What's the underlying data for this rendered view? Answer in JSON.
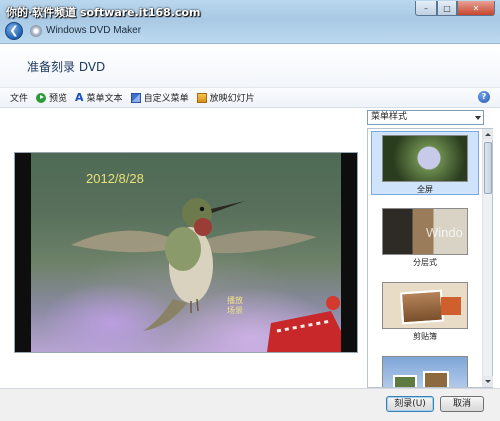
{
  "watermark": "你的·软件频道 software.it168.com",
  "window": {
    "title": "Windows DVD Maker",
    "controls": {
      "minimize": "–",
      "maximize": "□",
      "close": "✕"
    }
  },
  "page_title": "准备刻录 DVD",
  "toolbar": {
    "file": "文件",
    "preview": "预览",
    "menu_text": "菜单文本",
    "customize_menu": "自定义菜单",
    "slideshow": "放映幻灯片",
    "help": "?"
  },
  "preview": {
    "date_text": "2012/8/28",
    "play_label_line1": "播放",
    "play_label_line2": "场景"
  },
  "style_panel": {
    "dropdown_value": "菜单样式",
    "items": [
      {
        "label": "全屏",
        "selected": true
      },
      {
        "label": "分层式",
        "selected": false
      },
      {
        "label": "剪贴簿",
        "selected": false
      },
      {
        "label": "",
        "selected": false
      }
    ]
  },
  "footer": {
    "burn_button": "刻录(U)",
    "cancel_button": "取消"
  },
  "icons": {
    "back": "back-arrow-icon",
    "app": "dvd-icon",
    "preview": "play-icon",
    "menu_text": "text-icon",
    "customize": "customize-icon",
    "slideshow": "slideshow-icon",
    "help": "help-icon"
  },
  "colors": {
    "titlebar": "#a9c9e4",
    "title_text": "#1f3a63",
    "selection": "#cfe4fb",
    "date_overlay": "#e8e07a"
  }
}
